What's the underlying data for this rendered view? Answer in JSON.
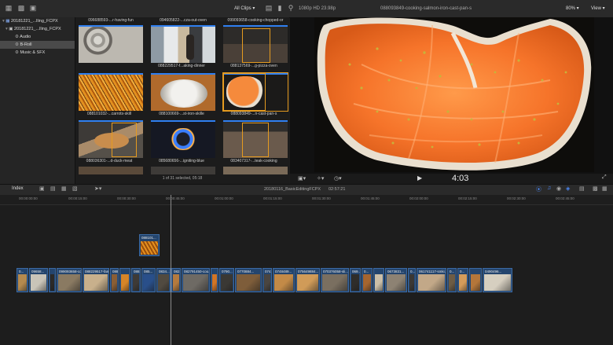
{
  "toolbar": {
    "clip_filter": "All Clips",
    "format": "1080p HD 23.98p",
    "viewer_title": "088093849-cooking-salmon-iron-cast-pan-s",
    "zoom": "80%",
    "view_label": "View"
  },
  "sidebar": {
    "items": [
      {
        "label": "20181221_...lling_FCPX"
      },
      {
        "label": "20181221_...lling_FCPX"
      },
      {
        "label": "Audio"
      },
      {
        "label": "B-Roll"
      },
      {
        "label": "Music & SFX"
      }
    ]
  },
  "browser": {
    "top_captions": [
      "096688593-...r-having-fun",
      "094605822-...cza-out-oven",
      "099093658-cooking-chopped-or"
    ],
    "captions": [
      "088229517-f...aking-dinner",
      "088137569-...g-pizza-oven",
      "088101032-...carrots-skill",
      "088100669-...st-iron-skille",
      "088093849-...n-cast-pan-s",
      "088036301-...d-duck-meat",
      "085680656-...igniting-blue",
      "083407317-...teak-cooking"
    ],
    "status": "1 of 31 selected, 05:18"
  },
  "viewer": {
    "timecode": "4:03"
  },
  "timeline_header": {
    "index_label": "Index",
    "project_name": "20180116_BasicEditingFCPX",
    "duration": "02:57:21"
  },
  "ruler": {
    "ticks": [
      "00:00:00:00",
      "00:00:15:00",
      "00:00:30:00",
      "00:00:45:00",
      "00:01:00:00",
      "00:01:15:00",
      "00:01:30:00",
      "00:01:45:00",
      "00:02:00:00",
      "00:02:15:00",
      "00:02:30:00",
      "00:02:45:00"
    ]
  },
  "timeline": {
    "connected_clip": "088101...",
    "clips": [
      {
        "label": "0...",
        "color": "#b58a4e"
      },
      {
        "label": "09658...",
        "color": "#c9c4b8"
      },
      {
        "label": "",
        "color": "#2c2a28"
      },
      {
        "label": "099093658-cooki...",
        "color": "#8a7a62"
      },
      {
        "label": "088229517-famil...",
        "color": "#c8b08c"
      },
      {
        "label": "0881...",
        "color": "#8a5e35"
      },
      {
        "label": "",
        "color": "#d68528"
      },
      {
        "label": "088...",
        "color": "#3e3a36"
      },
      {
        "label": "085...",
        "color": "#294f8a"
      },
      {
        "label": "0834...",
        "color": "#514a40"
      },
      {
        "label": "082...",
        "color": "#b47a3e"
      },
      {
        "label": "082791450-coo...",
        "color": "#6e6a64"
      },
      {
        "label": "",
        "color": "#d27526"
      },
      {
        "label": "0790...",
        "color": "#3a3834"
      },
      {
        "label": "0770884...",
        "color": "#7e5d3a"
      },
      {
        "label": "074...",
        "color": "#4a4540"
      },
      {
        "label": "0748489...",
        "color": "#c38a47"
      },
      {
        "label": "075649884...",
        "color": "#d09b58"
      },
      {
        "label": "070376058-sli...",
        "color": "#7a6f60"
      },
      {
        "label": "069...",
        "color": "#2f2d2a"
      },
      {
        "label": "0...",
        "color": "#a6652f"
      },
      {
        "label": "",
        "color": "#cbbfa8"
      },
      {
        "label": "0673831...",
        "color": "#8d8273"
      },
      {
        "label": "0...",
        "color": "#3b3834"
      },
      {
        "label": "061741117-smki...",
        "color": "#c2a888"
      },
      {
        "label": "0...",
        "color": "#6e5c44"
      },
      {
        "label": "0...",
        "color": "#d59c5a"
      },
      {
        "label": "",
        "color": "#b4763a"
      },
      {
        "label": "0490496...",
        "color": "#d6cfc0"
      }
    ]
  }
}
